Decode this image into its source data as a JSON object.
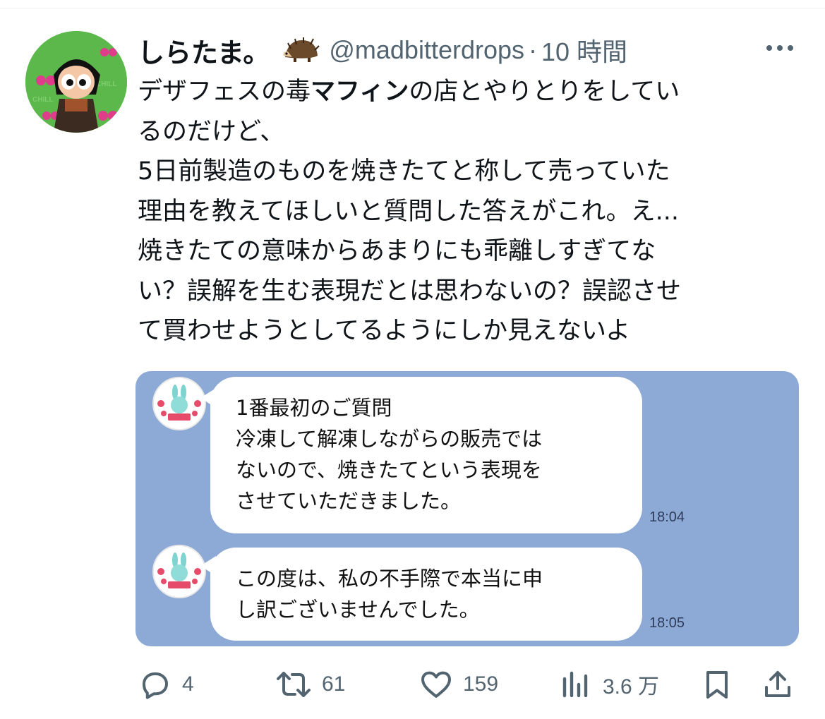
{
  "tweet": {
    "display_name": "しらたま。",
    "handle": "@madbitterdrops",
    "separator": "·",
    "time": "10 時間",
    "text_lines": [
      [
        "デザフェスの毒",
        "マフィン",
        "の店とやりとりをしてい"
      ],
      "るのだけど、",
      "5日前製造のものを焼きたてと称して売っていた",
      "理由を教えてほしいと質問した答えがこれ。え...",
      "焼きたての意味からあまりにも乖離しすぎてな",
      "い？誤解を生む表現だとは思わないの？誤認させ",
      "て買わせようとしてるようにしか見えないよ"
    ]
  },
  "media": {
    "background": "#8da9d6",
    "messages": [
      {
        "lines": [
          "1番最初のご質問",
          "冷凍して解凍しながらの販売では",
          "ないので、焼きたてという表現を",
          "させていただきました。"
        ],
        "time": "18:04"
      },
      {
        "lines": [
          "この度は、私の不手際で本当に申",
          "し訳ございませんでした。"
        ],
        "time": "18:05"
      }
    ]
  },
  "actions": {
    "reply_count": "4",
    "retweet_count": "61",
    "like_count": "159",
    "views_count": "3.6 万"
  },
  "icons": {
    "hedgehog": "hedgehog-emoji",
    "more": "more-icon",
    "reply": "reply-icon",
    "retweet": "retweet-icon",
    "like": "heart-icon",
    "views": "views-icon",
    "bookmark": "bookmark-icon",
    "share": "share-icon"
  },
  "colors": {
    "text": "#0f1419",
    "secondary": "#536471",
    "avatar_bg": "#5cb84a"
  }
}
